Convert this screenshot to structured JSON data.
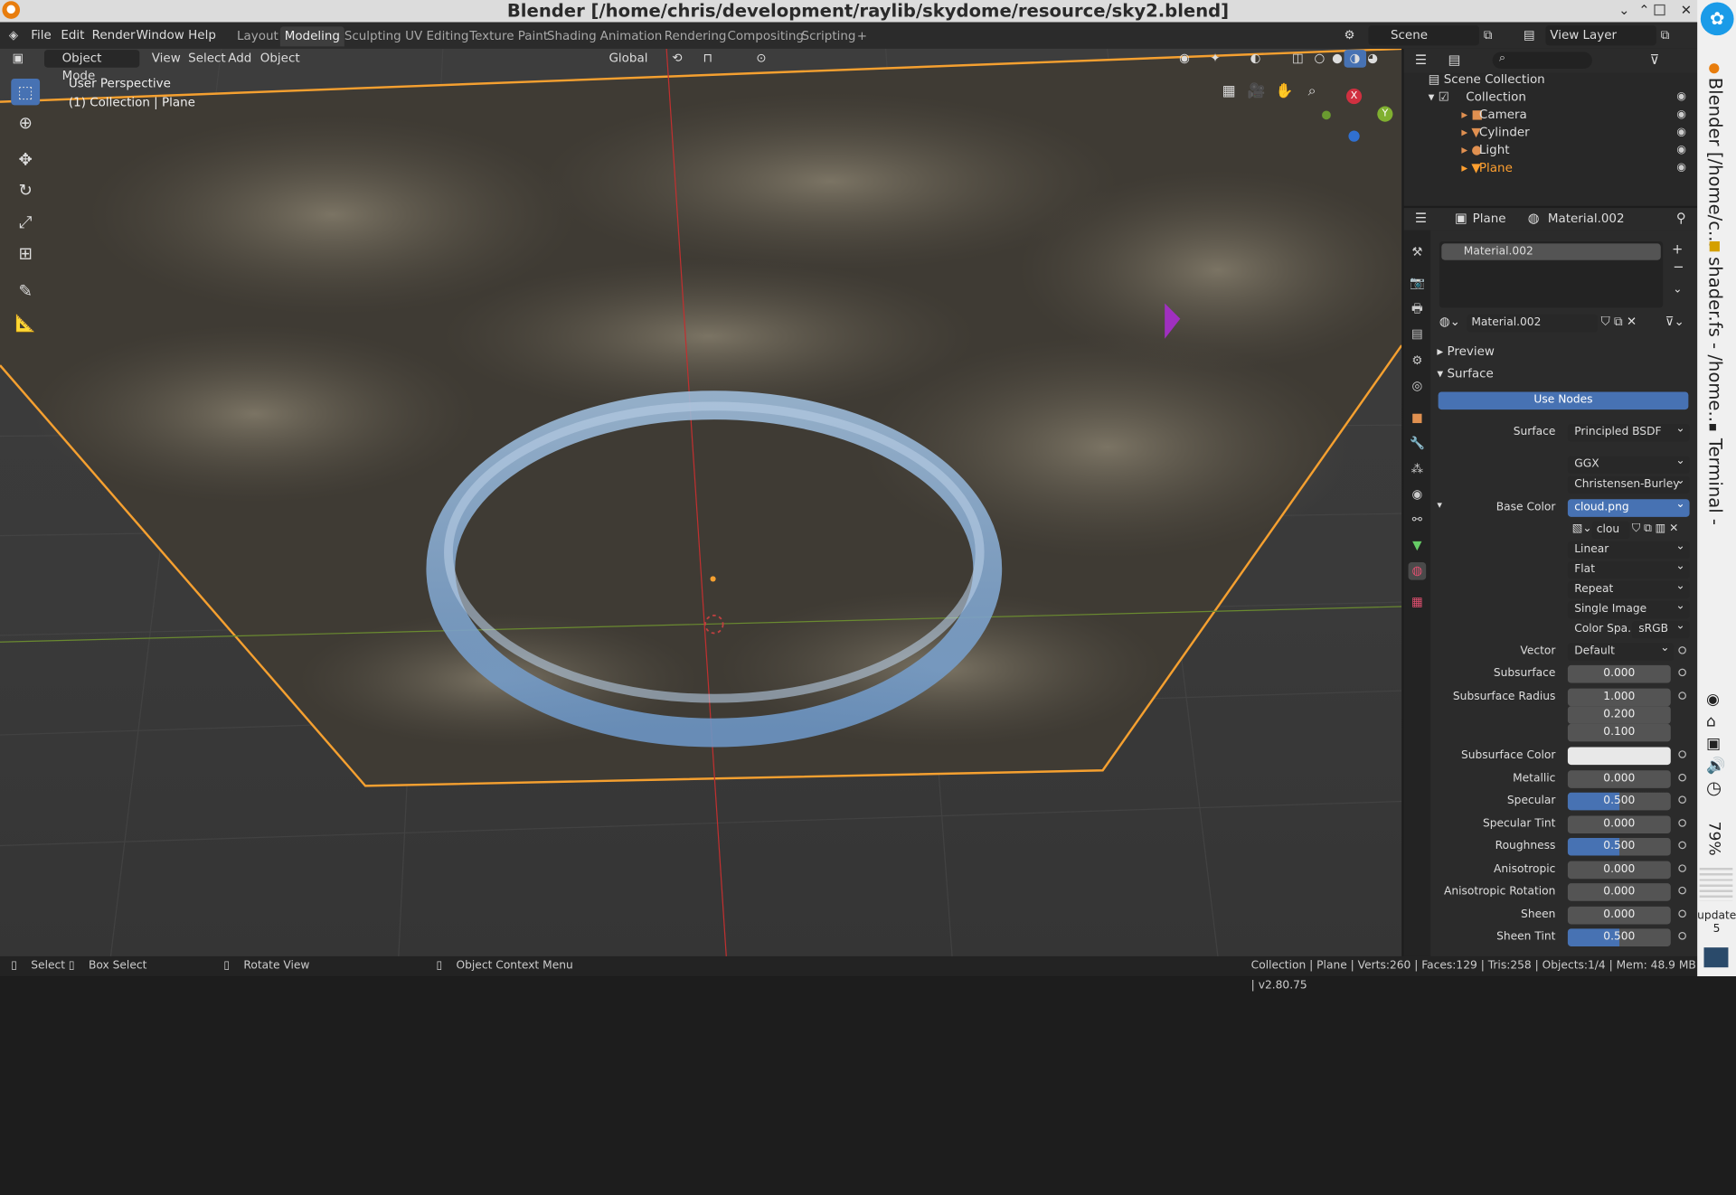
{
  "window": {
    "title": "Blender [/home/chris/development/raylib/skydome/resource/sky2.blend]",
    "logo": "blender-logo",
    "minimize": "⌄",
    "restore": "⌃",
    "close": "✕"
  },
  "menu": {
    "items": [
      "File",
      "Edit",
      "Render",
      "Window",
      "Help"
    ]
  },
  "workspaces": {
    "tabs": [
      "Layout",
      "Modeling",
      "Sculpting",
      "UV Editing",
      "Texture Paint",
      "Shading",
      "Animation",
      "Rendering",
      "Compositing",
      "Scripting"
    ],
    "active": "Modeling",
    "add": "+"
  },
  "scene": {
    "name": "Scene",
    "view_layer": "View Layer"
  },
  "viewport": {
    "mode": "Object Mode",
    "menu": [
      "View",
      "Select",
      "Add",
      "Object"
    ],
    "orientation": "Global",
    "perspective": "User Perspective",
    "collection": "(1) Collection | Plane",
    "axis_x": "X",
    "axis_y": "Y"
  },
  "outliner": {
    "search_placeholder": "",
    "root": "Scene Collection",
    "collection": "Collection",
    "objects": [
      {
        "name": "Camera",
        "color": "#e09050"
      },
      {
        "name": "Cylinder",
        "color": "#e09050"
      },
      {
        "name": "Light",
        "color": "#e09050"
      },
      {
        "name": "Plane",
        "color": "#ffa030"
      }
    ]
  },
  "properties": {
    "object": "Plane",
    "material": "Material.002",
    "slot": "Material.002",
    "datablock": "Material.002",
    "preview_label": "Preview",
    "surface_label": "Surface",
    "use_nodes": "Use Nodes",
    "surface_shader": "Principled BSDF",
    "distribution": "GGX",
    "subsurface_method": "Christensen-Burley",
    "base_color_label": "Base Color",
    "base_color_tex": "cloud.png",
    "image_name": "clou",
    "interp": "Linear",
    "projection": "Flat",
    "extension": "Repeat",
    "source": "Single Image",
    "colorspace_label": "Color Spa..",
    "colorspace": "sRGB",
    "vector_label": "Vector",
    "vector": "Default",
    "rows": [
      {
        "label": "Subsurface",
        "value": "0.000"
      },
      {
        "label": "Subsurface Radius",
        "value": "1.000"
      },
      {
        "label": "",
        "value": "0.200"
      },
      {
        "label": "",
        "value": "0.100"
      },
      {
        "label": "Subsurface Color",
        "value": ""
      },
      {
        "label": "Metallic",
        "value": "0.000"
      },
      {
        "label": "Specular",
        "value": "0.500",
        "fill": 0.5
      },
      {
        "label": "Specular Tint",
        "value": "0.000"
      },
      {
        "label": "Roughness",
        "value": "0.500",
        "fill": 0.5
      },
      {
        "label": "Anisotropic",
        "value": "0.000"
      },
      {
        "label": "Anisotropic Rotation",
        "value": "0.000"
      },
      {
        "label": "Sheen",
        "value": "0.000"
      },
      {
        "label": "Sheen Tint",
        "value": "0.500",
        "fill": 0.5
      }
    ]
  },
  "statusbar": {
    "select": "Select",
    "box_select": "Box Select",
    "rotate": "Rotate View",
    "context": "Object Context Menu",
    "stats": "Collection | Plane | Verts:260 | Faces:129 | Tris:258 | Objects:1/4 | Mem: 48.9 MB | v2.80.75"
  },
  "taskbar": {
    "item1": "Blender [/home/c...",
    "item2": "shader.fs - /home...",
    "item3": "Terminal -",
    "battery": "79%",
    "updates": "updates",
    "updates_count": "5"
  }
}
